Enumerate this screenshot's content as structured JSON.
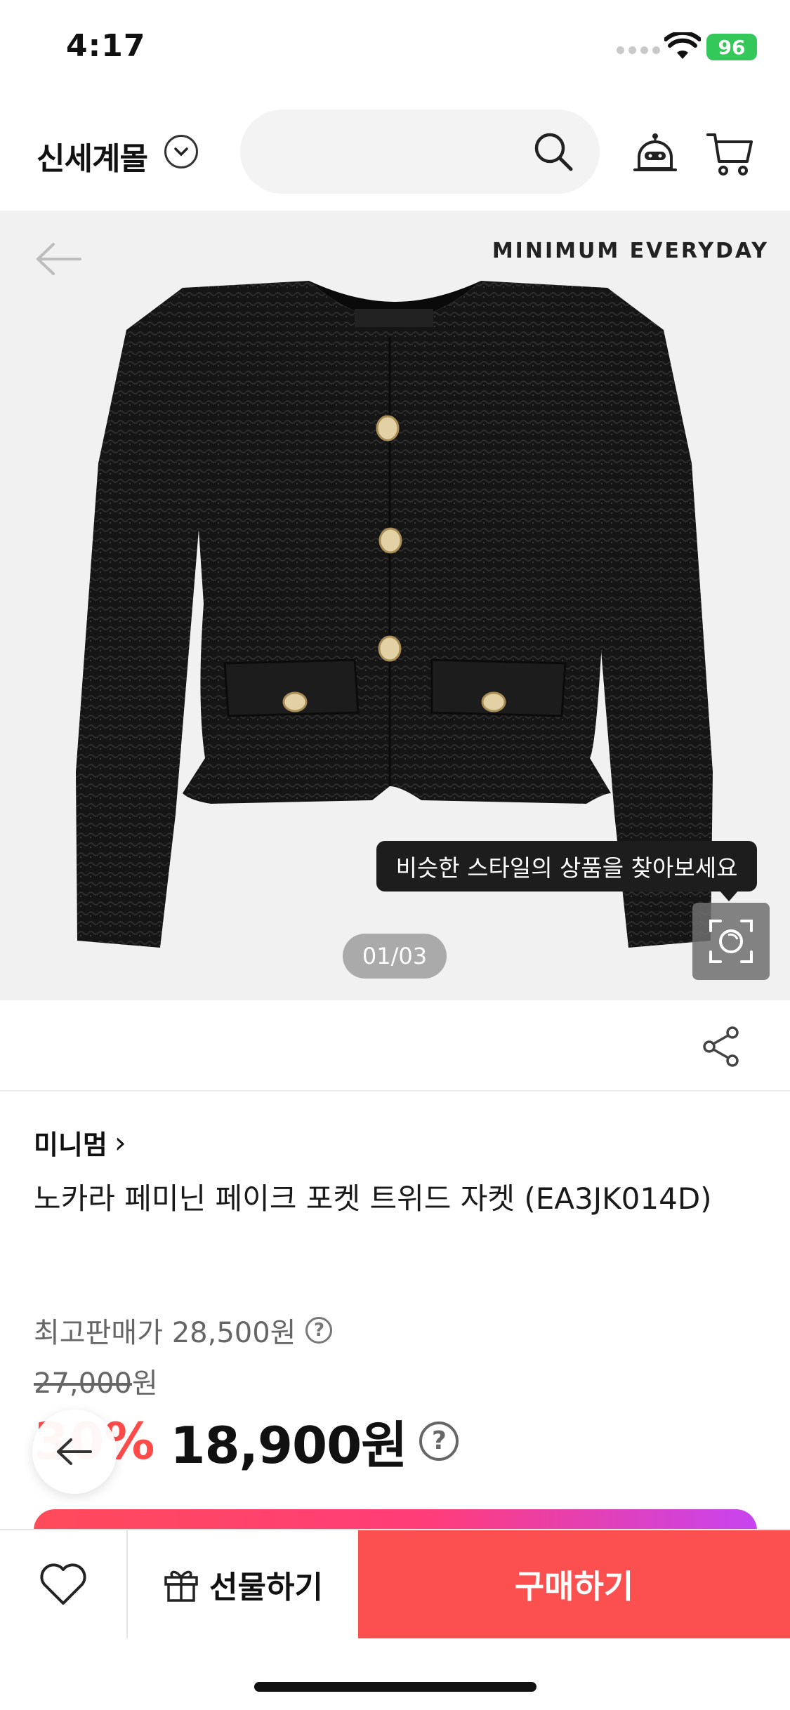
{
  "status_bar": {
    "time": "4:17",
    "battery": "96"
  },
  "header": {
    "mall_name": "신세계몰"
  },
  "product_image": {
    "brand_watermark": "MINIMUM EVERYDAY",
    "tooltip": "비슷한 스타일의 상품을 찾아보세요",
    "page_indicator": "01/03"
  },
  "product": {
    "brand": "미니멈",
    "brand_chevron": "›",
    "title": "노카라 페미닌 페이크 포켓 트위드 자켓 (EA3JK014D)",
    "max_price_label": "최고판매가 28,500원",
    "original_price_number": "27,000",
    "original_price_unit": "원",
    "discount": "30%",
    "sale_price": "18,900원",
    "help_glyph": "?"
  },
  "bottom_bar": {
    "gift_label": "선물하기",
    "buy_label": "구매하기"
  },
  "colors": {
    "accent": "#fc5050",
    "discount": "#ff4a4a",
    "battery": "#34c759"
  },
  "icons": [
    "wifi-icon",
    "chevron-down-icon",
    "search-icon",
    "chatbot-icon",
    "cart-icon",
    "back-arrow-icon",
    "lens-search-icon",
    "share-icon",
    "help-icon",
    "heart-icon",
    "gift-icon"
  ]
}
